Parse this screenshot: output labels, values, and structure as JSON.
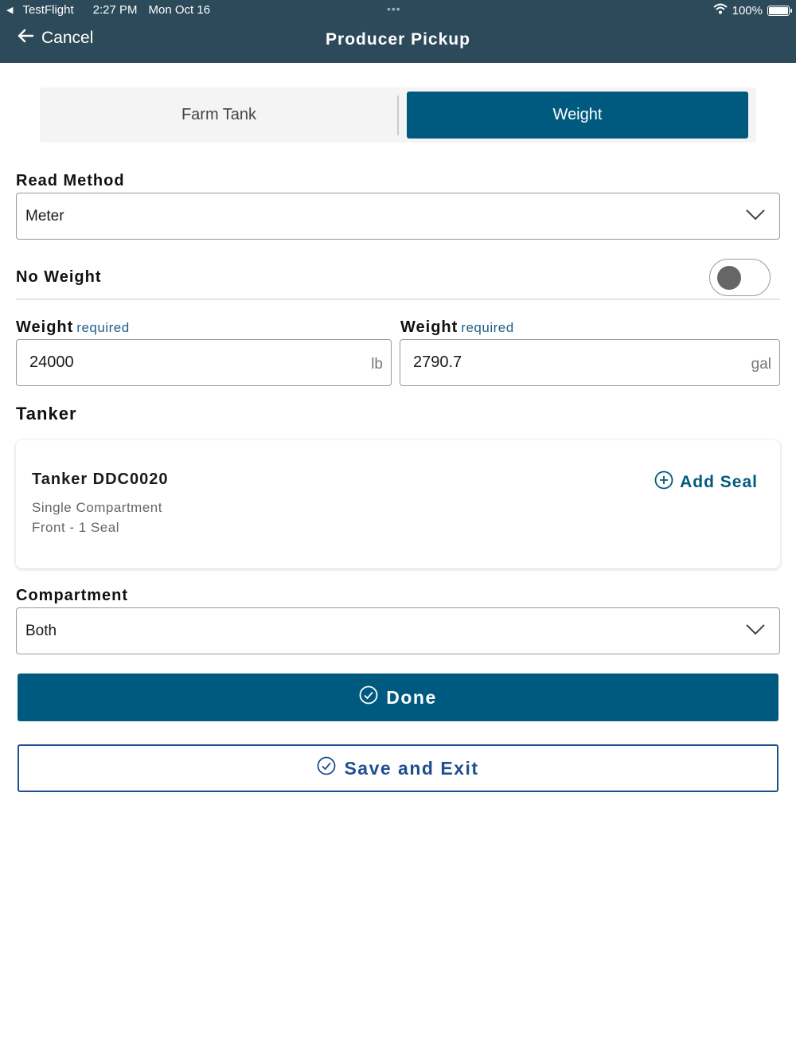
{
  "status_bar": {
    "back_app": "TestFlight",
    "time": "2:27 PM",
    "date": "Mon Oct 16",
    "battery": "100%",
    "multitask_dots": "•••"
  },
  "header": {
    "cancel_label": "Cancel",
    "title": "Producer Pickup",
    "background_color": "#2c4a5a"
  },
  "segmented": {
    "options": [
      "Farm Tank",
      "Weight"
    ],
    "selected": "Weight"
  },
  "read_method": {
    "label": "Read Method",
    "value": "Meter"
  },
  "no_weight": {
    "label": "No Weight",
    "toggle_on": false
  },
  "weight_lb": {
    "label": "Weight",
    "required": "required",
    "value": "24000",
    "unit": "lb"
  },
  "weight_gal": {
    "label": "Weight",
    "required": "required",
    "value": "2790.7",
    "unit": "gal"
  },
  "tanker": {
    "section_label": "Tanker",
    "name": "Tanker DDC0020",
    "compartment_type": "Single Compartment",
    "seal_info": "Front - 1 Seal",
    "add_seal_label": "Add Seal"
  },
  "compartment": {
    "label": "Compartment",
    "value": "Both"
  },
  "actions": {
    "done_label": "Done",
    "save_exit_label": "Save and Exit",
    "primary_color": "#005a80"
  }
}
